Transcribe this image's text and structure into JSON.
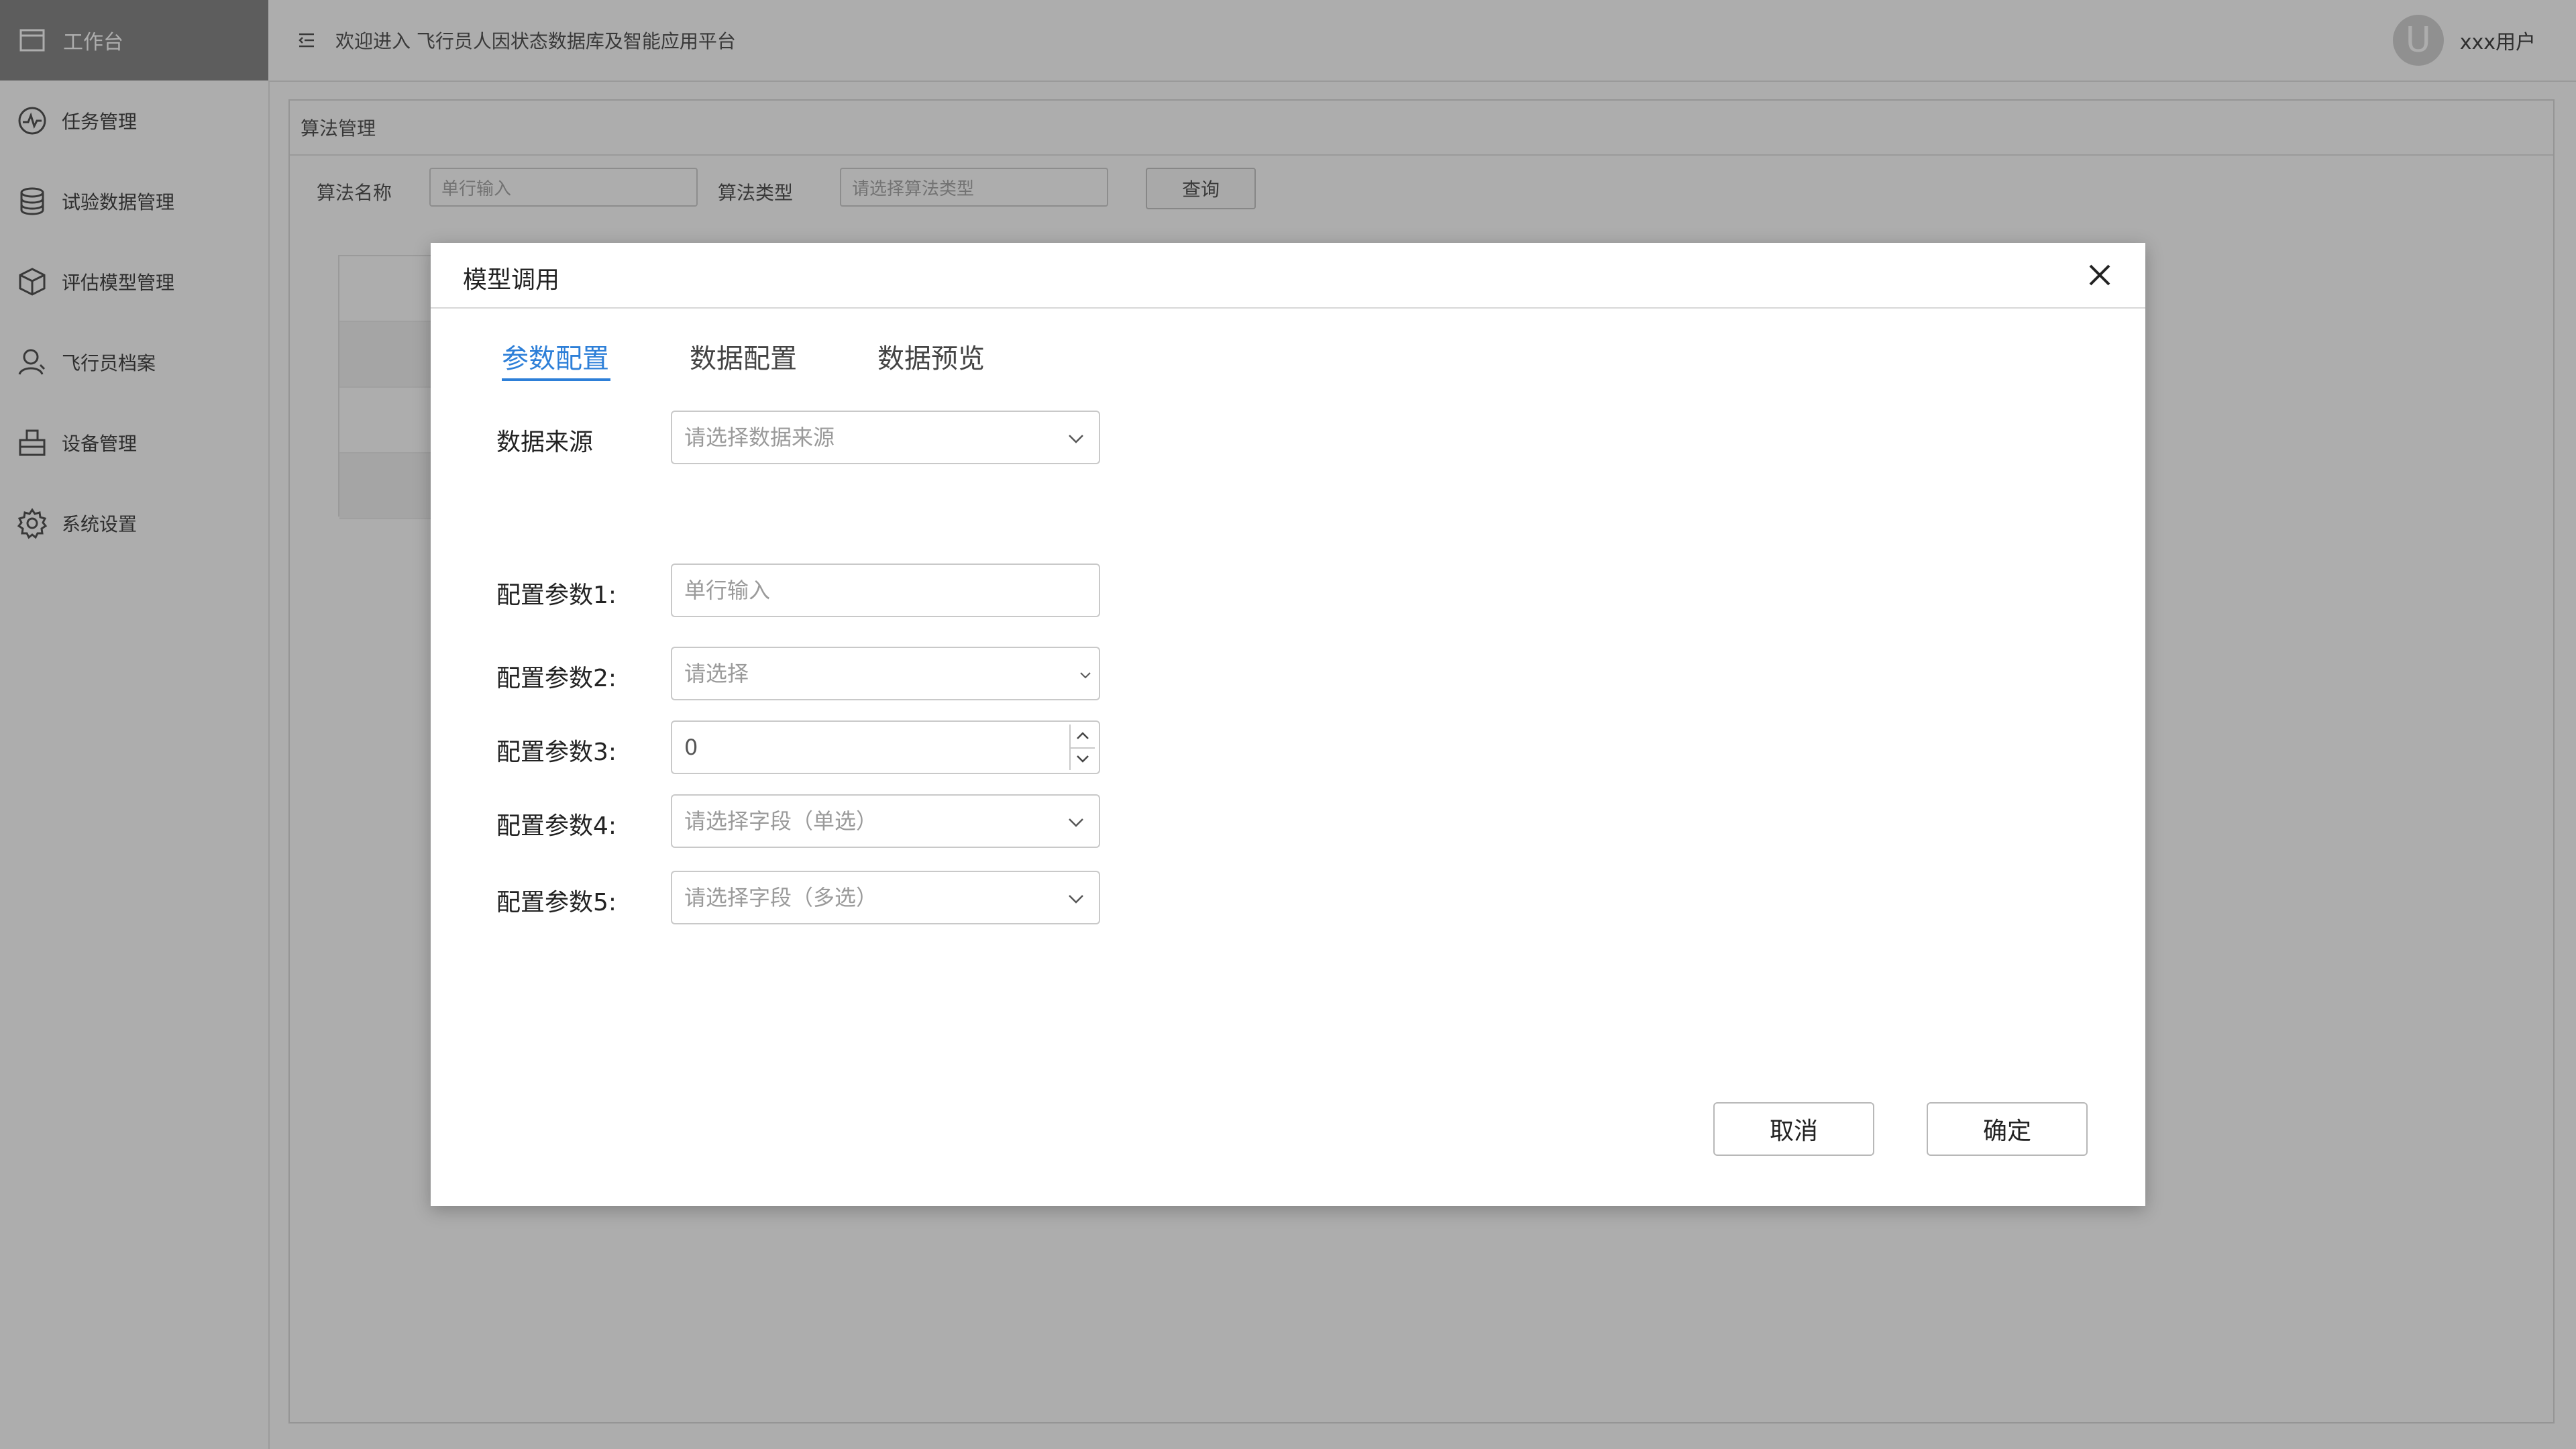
{
  "sidebar": {
    "brand_label": "工作台",
    "items": [
      {
        "label": "任务管理",
        "icon": "pulse-icon"
      },
      {
        "label": "试验数据管理",
        "icon": "database-icon"
      },
      {
        "label": "评估模型管理",
        "icon": "cube-icon"
      },
      {
        "label": "飞行员档案",
        "icon": "person-icon"
      },
      {
        "label": "设备管理",
        "icon": "device-icon"
      },
      {
        "label": "系统设置",
        "icon": "gear-icon"
      }
    ]
  },
  "header": {
    "welcome": "欢迎进入 飞行员人因状态数据库及智能应用平台",
    "avatar_letter": "U",
    "user_name": "xxx用户"
  },
  "page": {
    "section_title": "算法管理",
    "filter": {
      "name_label": "算法名称",
      "name_placeholder": "单行输入",
      "type_label": "算法类型",
      "type_placeholder": "请选择算法类型",
      "query_button": "查询"
    }
  },
  "modal": {
    "title": "模型调用",
    "tabs": [
      {
        "label": "参数配置",
        "active": true
      },
      {
        "label": "数据配置",
        "active": false
      },
      {
        "label": "数据预览",
        "active": false
      }
    ],
    "data_source": {
      "label": "数据来源",
      "placeholder": "请选择数据来源"
    },
    "params": [
      {
        "label": "配置参数1:",
        "placeholder": "单行输入",
        "kind": "text"
      },
      {
        "label": "配置参数2:",
        "placeholder": "请选择",
        "kind": "select"
      },
      {
        "label": "配置参数3:",
        "value": "0",
        "kind": "number"
      },
      {
        "label": "配置参数4:",
        "placeholder": "请选择字段（单选）",
        "kind": "select"
      },
      {
        "label": "配置参数5:",
        "placeholder": "请选择字段（多选）",
        "kind": "select"
      }
    ],
    "cancel_button": "取消",
    "confirm_button": "确定"
  },
  "colors": {
    "accent": "#2d7fd8",
    "mask": "rgba(0,0,0,0.32)"
  }
}
